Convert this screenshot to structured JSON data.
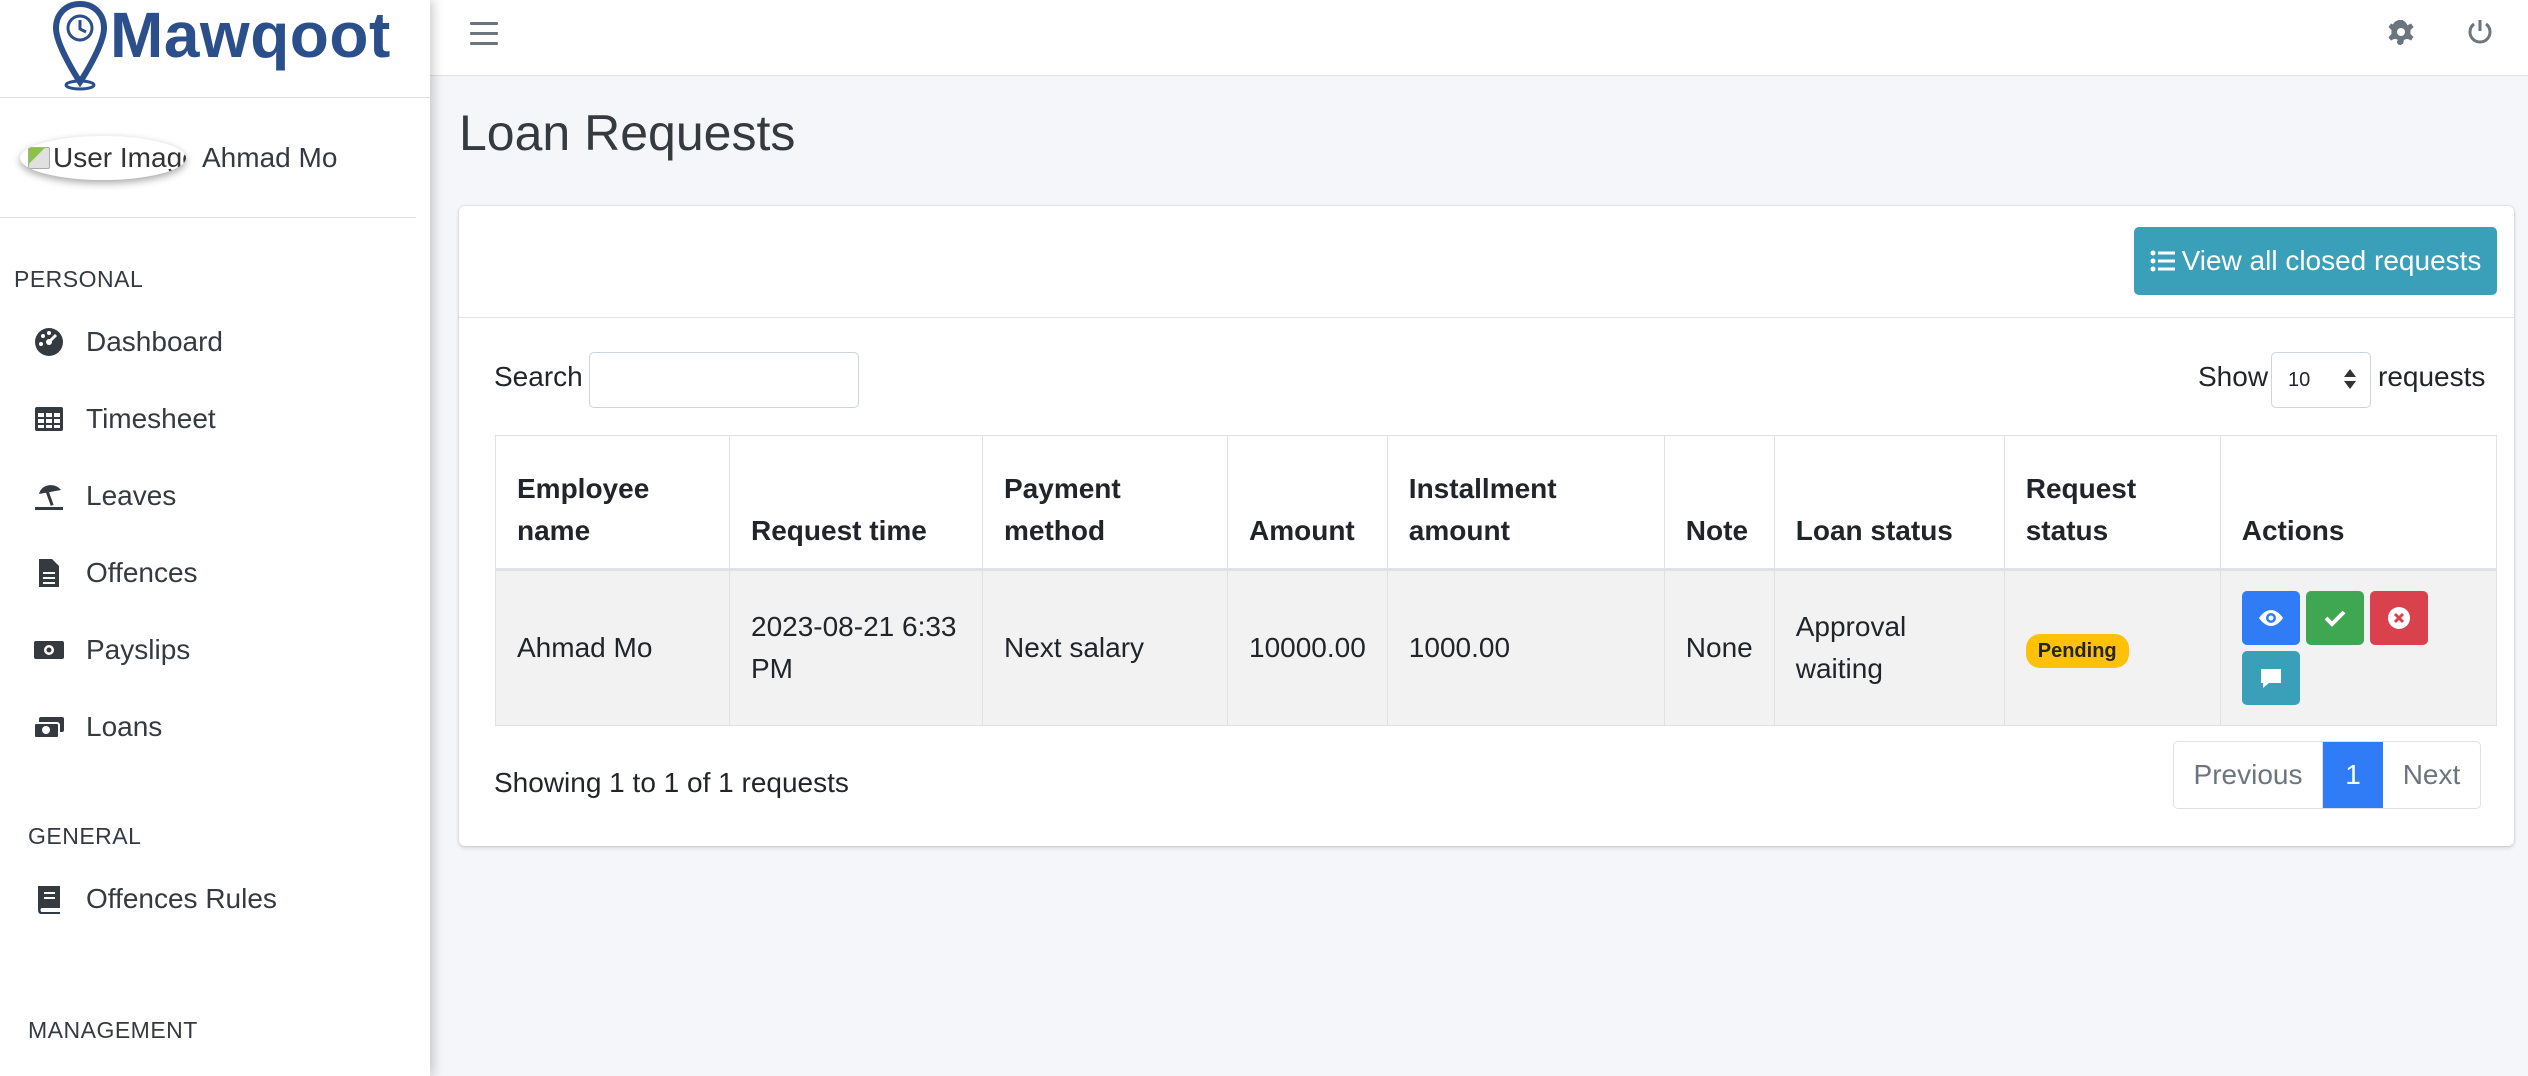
{
  "brand": {
    "name": "Mawqoot"
  },
  "user": {
    "image_alt": "User Image",
    "name": "Ahmad Mo"
  },
  "sidebar": {
    "sections": [
      {
        "header": "PERSONAL",
        "items": [
          {
            "label": "Dashboard",
            "icon": "dashboard-icon"
          },
          {
            "label": "Timesheet",
            "icon": "table-icon"
          },
          {
            "label": "Leaves",
            "icon": "umbrella-beach-icon"
          },
          {
            "label": "Offences",
            "icon": "document-icon"
          },
          {
            "label": "Payslips",
            "icon": "money-bill-icon"
          },
          {
            "label": "Loans",
            "icon": "money-exchange-icon"
          }
        ]
      },
      {
        "header": "GENERAL",
        "items": [
          {
            "label": "Offences Rules",
            "icon": "book-icon"
          }
        ]
      },
      {
        "header": "MANAGEMENT",
        "items": []
      }
    ]
  },
  "topbar": {
    "icons": [
      "menu-icon",
      "bell-icon",
      "gear-icon",
      "power-icon"
    ]
  },
  "page": {
    "title": "Loan Requests"
  },
  "card": {
    "closed_button": "View all closed requests",
    "search_label": "Search",
    "search_value": "",
    "show_label": "Show",
    "show_value": "10",
    "requests_label": "requests"
  },
  "table": {
    "headers": [
      "Employee name",
      "Request time",
      "Payment method",
      "Amount",
      "Installment amount",
      "Note",
      "Loan status",
      "Request status",
      "Actions"
    ],
    "rows": [
      {
        "employee": "Ahmad Mo",
        "time": "2023-08-21 6:33 PM",
        "method": "Next salary",
        "amount": "10000.00",
        "installment": "1000.00",
        "note": "None",
        "loan_status": "Approval waiting",
        "request_status": "Pending"
      }
    ]
  },
  "footer": {
    "info": "Showing 1 to 1 of 1 requests",
    "prev": "Previous",
    "page": "1",
    "next": "Next"
  },
  "colors": {
    "brand": "#2a4f8a",
    "info": "#3a9fb8",
    "primary": "#2f7cf6",
    "success": "#3fa651",
    "danger": "#d9414d",
    "warning": "#ffc107"
  }
}
